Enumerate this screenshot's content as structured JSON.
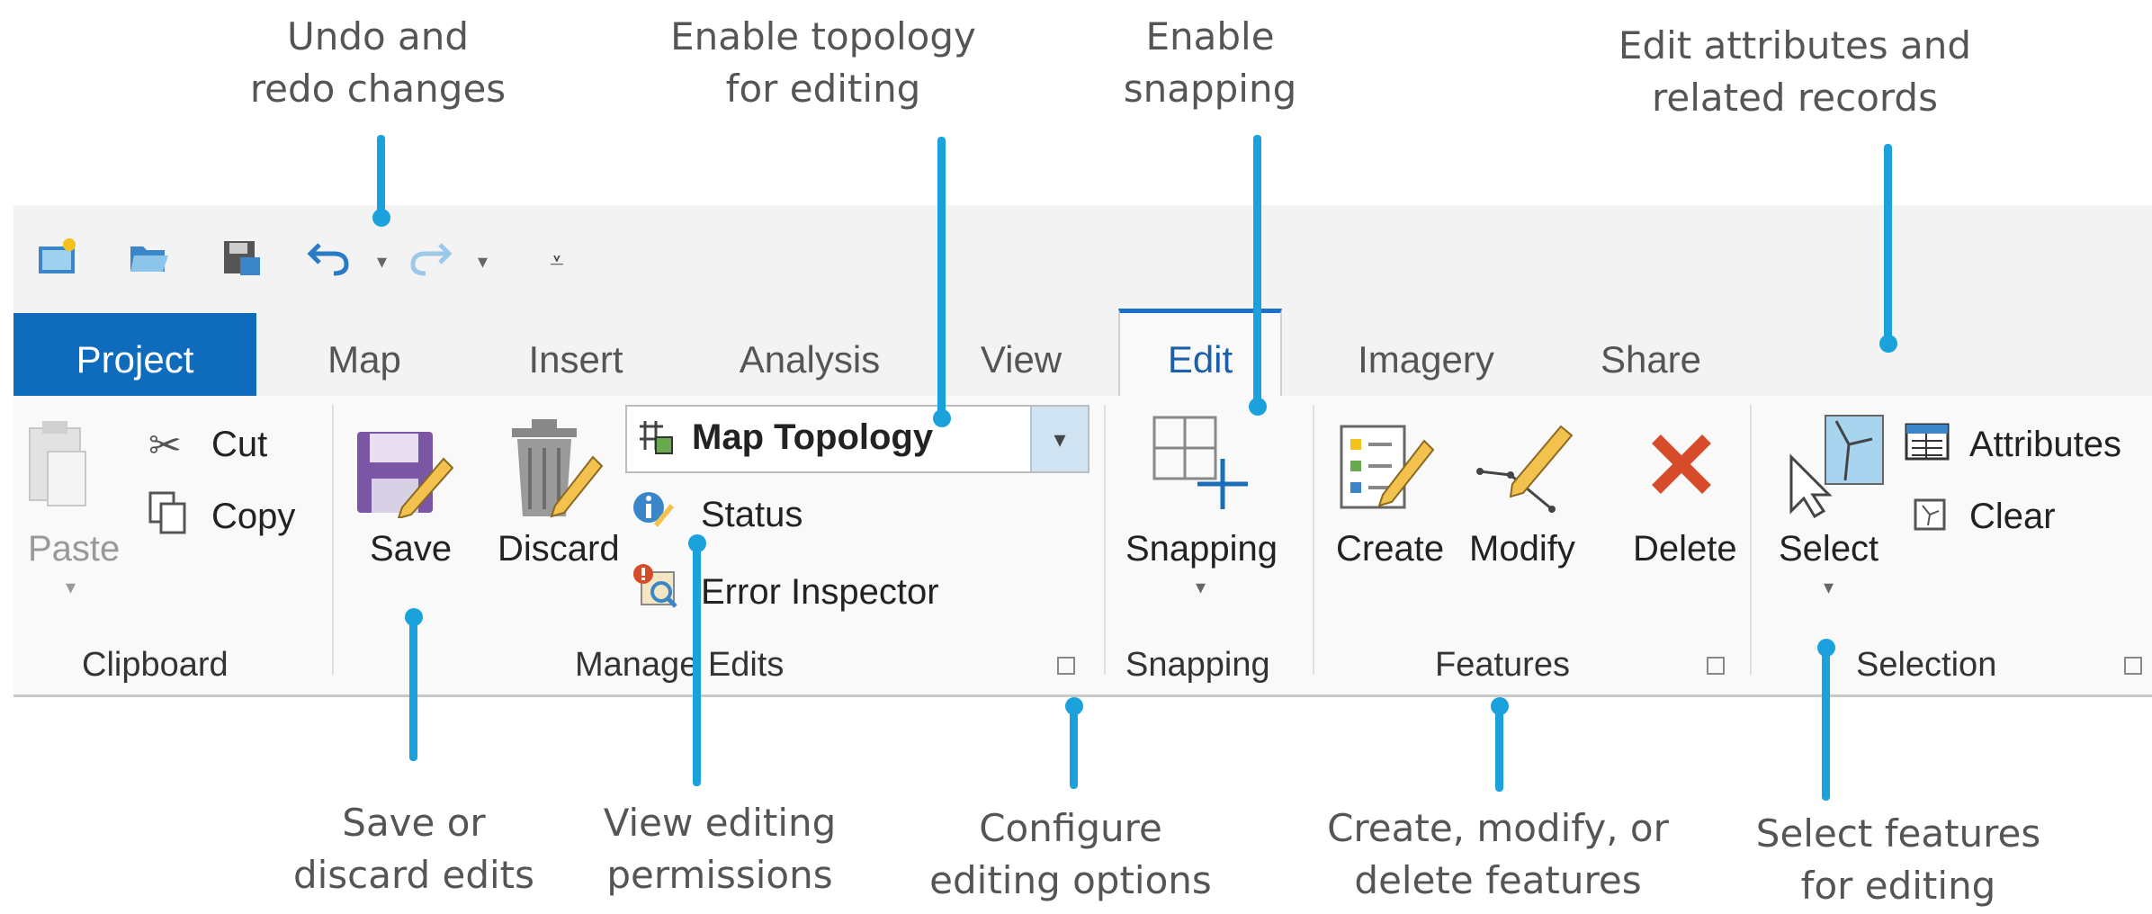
{
  "callouts": {
    "undo_redo": [
      "Undo and",
      "redo changes"
    ],
    "topology": [
      "Enable topology",
      "for editing"
    ],
    "snapping": [
      "Enable",
      "snapping"
    ],
    "attributes": [
      "Edit attributes and",
      "related records"
    ],
    "save_discard": [
      "Save or",
      "discard edits"
    ],
    "permissions": [
      "View editing",
      "permissions"
    ],
    "configure": [
      "Configure",
      "editing options"
    ],
    "features": [
      "Create, modify, or",
      "delete features"
    ],
    "select": [
      "Select features",
      "for editing"
    ]
  },
  "tabs": [
    "Project",
    "Map",
    "Insert",
    "Analysis",
    "View",
    "Edit",
    "Imagery",
    "Share"
  ],
  "active_tab": "Edit",
  "clipboard": {
    "paste": "Paste",
    "cut": "Cut",
    "copy": "Copy",
    "group": "Clipboard"
  },
  "manage_edits": {
    "save": "Save",
    "discard": "Discard",
    "topology_value": "Map Topology",
    "status": "Status",
    "error_inspector": "Error Inspector",
    "group": "Manage Edits"
  },
  "snapping": {
    "button": "Snapping",
    "group": "Snapping"
  },
  "features": {
    "create": "Create",
    "modify": "Modify",
    "delete": "Delete",
    "group": "Features"
  },
  "selection": {
    "select": "Select",
    "attributes": "Attributes",
    "clear": "Clear",
    "group": "Selection"
  },
  "colors": {
    "accent": "#1ba1dc",
    "project_tab": "#0f6cbd",
    "ribbon": "#f9f9f9"
  },
  "icons": [
    "new-project-icon",
    "open-project-icon",
    "save-project-icon",
    "undo-icon",
    "redo-icon",
    "customize-icon",
    "paste-icon",
    "cut-icon",
    "copy-icon",
    "save-edits-icon",
    "discard-icon",
    "topology-icon",
    "status-icon",
    "error-inspector-icon",
    "snapping-icon",
    "create-icon",
    "modify-icon",
    "delete-icon",
    "select-icon",
    "attributes-icon",
    "clear-icon"
  ]
}
